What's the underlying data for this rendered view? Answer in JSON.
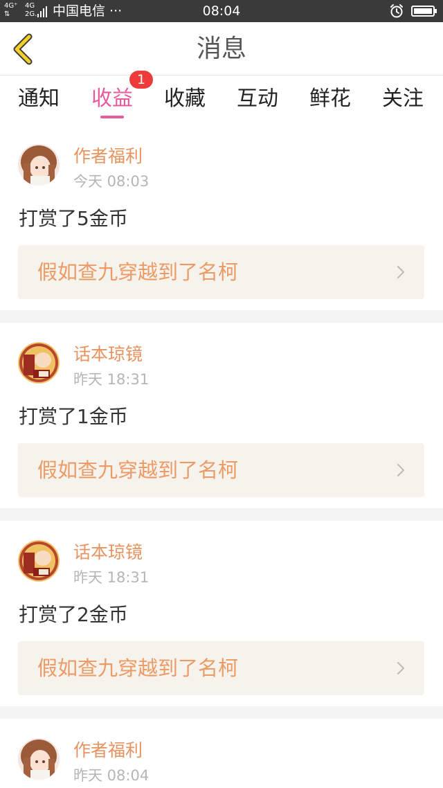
{
  "status_bar": {
    "network_left_top": "4G⁺",
    "network_left_bottom": "⇅",
    "network_right_top": "4G",
    "network_right_bottom": "2G.",
    "carrier": "中国电信 ···",
    "time": "08:04",
    "alarm_icon": "alarm-clock-icon",
    "battery_icon": "battery-full-icon"
  },
  "header": {
    "title": "消息",
    "back_icon": "chevron-left-icon",
    "accent_color": "#e6c31e"
  },
  "tabs": {
    "items": [
      "通知",
      "收益",
      "收藏",
      "互动",
      "鲜花",
      "关注"
    ],
    "active_index": 1,
    "active_color": "#e85a9b",
    "badge": "1"
  },
  "messages": [
    {
      "sender": "作者福利",
      "time": "今天 08:03",
      "text": "打赏了5金币",
      "link": "假如查九穿越到了名柯"
    },
    {
      "sender": "话本琼镜",
      "time": "昨天 18:31",
      "text": "打赏了1金币",
      "link": "假如查九穿越到了名柯"
    },
    {
      "sender": "话本琼镜",
      "time": "昨天 18:31",
      "text": "打赏了2金币",
      "link": "假如查九穿越到了名柯"
    },
    {
      "sender": "作者福利",
      "time": "昨天 08:04"
    }
  ]
}
